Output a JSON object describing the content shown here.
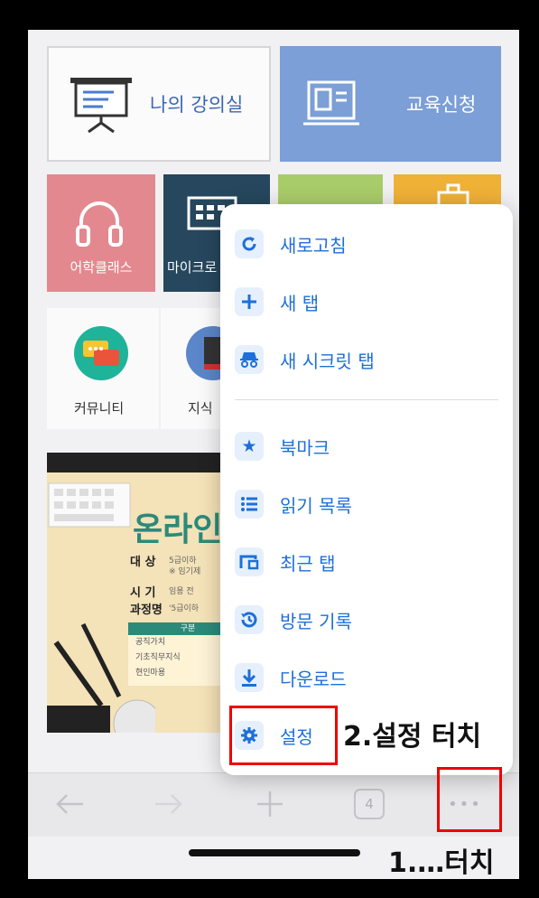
{
  "tiles": {
    "lecture": "나의 강의실",
    "apply": "교육신청",
    "language": "어학클래스",
    "micro": "마이크로",
    "community": "커뮤니티",
    "knowledge": "지식"
  },
  "poster": {
    "title": "온라인",
    "target_label": "대 상",
    "target_value": "5급이하",
    "target_note": "※ 임기제",
    "period_label": "시 기",
    "period_value": "임용 전",
    "course_label": "과정명",
    "course_value": "'5급이하",
    "table_header": "구분",
    "table_rows": [
      "공직가치",
      "기초직무지식",
      "현인마용"
    ]
  },
  "toolbar": {
    "tab_count": "4",
    "more_label": "•••"
  },
  "menu": {
    "items": [
      {
        "label": "새로고침",
        "icon": "refresh-icon"
      },
      {
        "label": "새 탭",
        "icon": "plus-icon"
      },
      {
        "label": "새 시크릿 탭",
        "icon": "incognito-icon"
      },
      {
        "label": "북마크",
        "icon": "star-icon"
      },
      {
        "label": "읽기 목록",
        "icon": "list-icon"
      },
      {
        "label": "최근 탭",
        "icon": "recent-tabs-icon"
      },
      {
        "label": "방문 기록",
        "icon": "history-icon"
      },
      {
        "label": "다운로드",
        "icon": "download-icon"
      },
      {
        "label": "설정",
        "icon": "gear-icon"
      }
    ]
  },
  "annotations": {
    "step2": "2.설정 터치",
    "step1": "1.…터치"
  },
  "colors": {
    "accent": "#1e6fd9",
    "highlight": "#e00000"
  }
}
